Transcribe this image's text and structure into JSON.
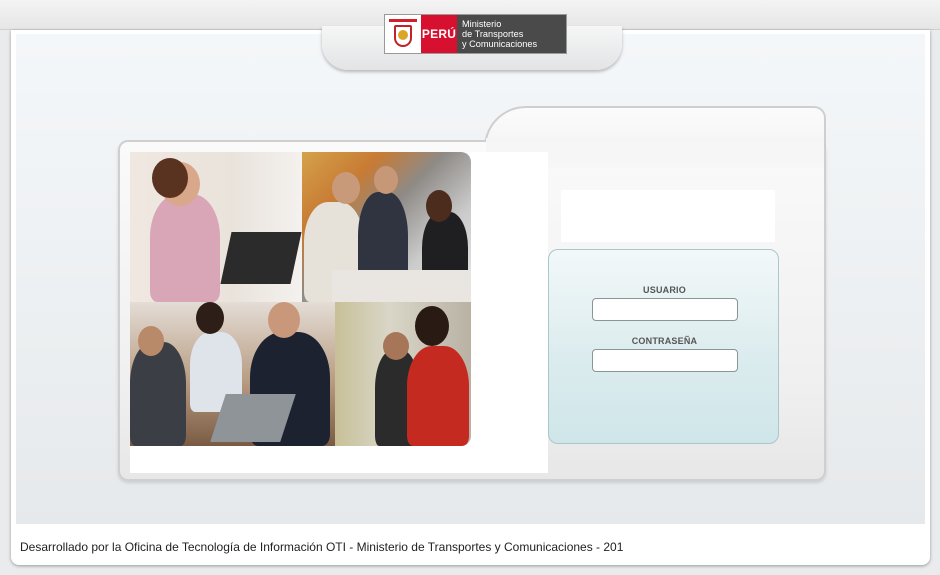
{
  "header": {
    "logo": {
      "country": "PERÚ",
      "ministry_lines": [
        "Ministerio",
        "de Transportes",
        "y Comunicaciones"
      ],
      "crest_name": "peru-coat-of-arms"
    },
    "brand_color": "#d8102f"
  },
  "login": {
    "user_label": "USUARIO",
    "user_value": "",
    "password_label": "CONTRASEÑA",
    "password_value": ""
  },
  "footer": {
    "text": "Desarrollado por la Oficina de Tecnología de Información OTI - Ministerio de Transportes y Comunicaciones - 201"
  }
}
